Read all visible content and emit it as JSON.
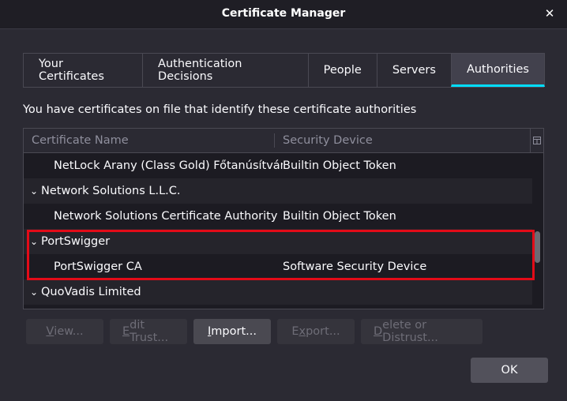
{
  "window": {
    "title": "Certificate Manager",
    "close_icon": "close-icon"
  },
  "tabs": [
    {
      "label": "Your Certificates",
      "selected": false
    },
    {
      "label": "Authentication Decisions",
      "selected": false
    },
    {
      "label": "People",
      "selected": false
    },
    {
      "label": "Servers",
      "selected": false
    },
    {
      "label": "Authorities",
      "selected": true
    }
  ],
  "description": "You have certificates on file that identify these certificate authorities",
  "table": {
    "columns": {
      "name": "Certificate Name",
      "device": "Security Device"
    },
    "rows": [
      {
        "type": "child",
        "name": "NetLock Arany (Class Gold) Főtanúsítvány",
        "device": "Builtin Object Token"
      },
      {
        "type": "group",
        "name": "Network Solutions L.L.C.",
        "device": ""
      },
      {
        "type": "child",
        "name": "Network Solutions Certificate Authority",
        "device": "Builtin Object Token"
      },
      {
        "type": "group",
        "name": "PortSwigger",
        "device": ""
      },
      {
        "type": "child",
        "name": "PortSwigger CA",
        "device": "Software Security Device"
      },
      {
        "type": "group",
        "name": "QuoVadis Limited",
        "device": ""
      }
    ]
  },
  "buttons": {
    "view": {
      "first": "V",
      "rest": "iew..."
    },
    "edit_trust": {
      "first": "E",
      "rest": "dit Trust..."
    },
    "import": {
      "first": "I",
      "rest": "mport..."
    },
    "export": {
      "first": "x",
      "pre": "E",
      "rest": "port..."
    },
    "delete": {
      "first": "D",
      "rest": "elete or Distrust..."
    },
    "ok": "OK"
  },
  "colors": {
    "accent": "#00ddff",
    "highlight_box": "#e30b18"
  }
}
